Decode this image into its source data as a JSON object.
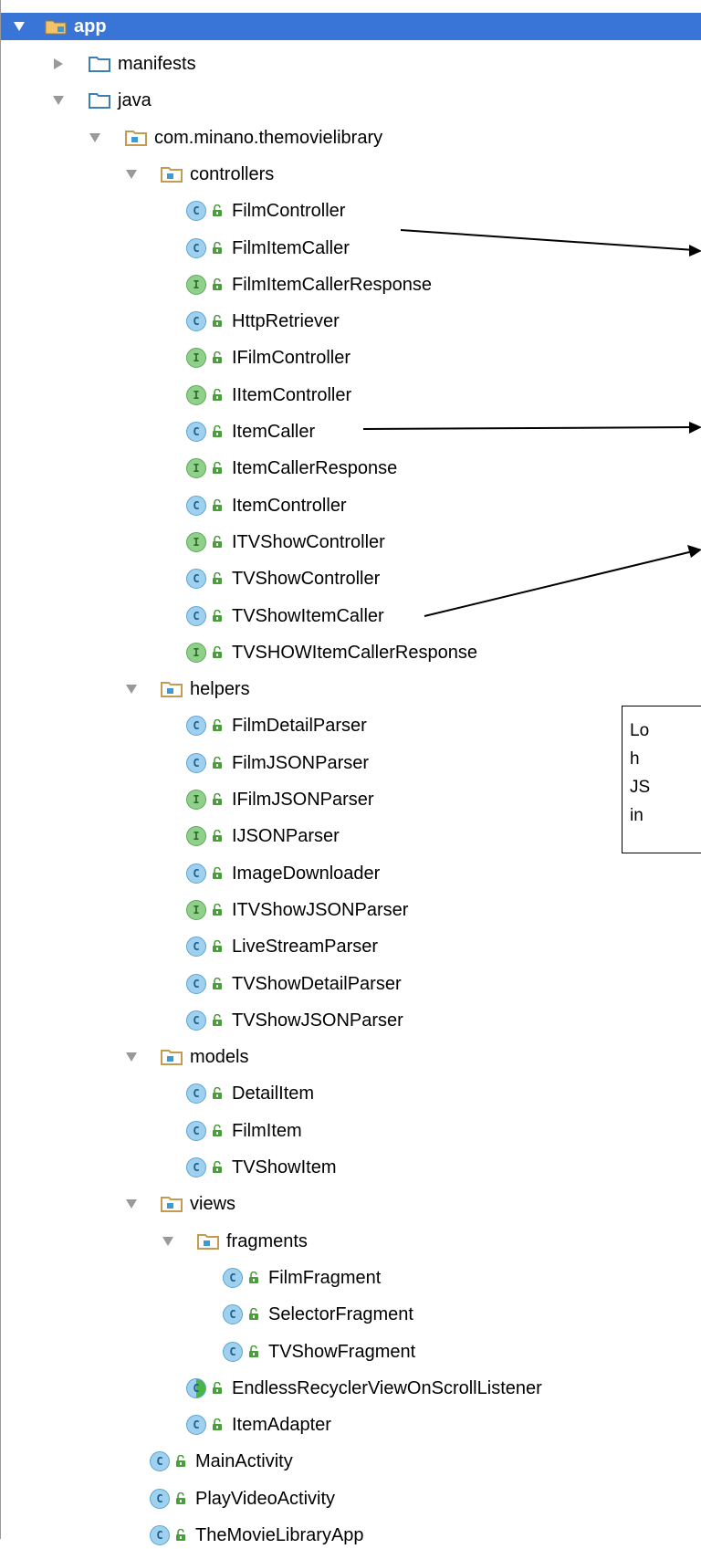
{
  "project_tree": {
    "root": {
      "label": "app"
    },
    "items": [
      {
        "label": "manifests",
        "kind": "folder",
        "depth": 1,
        "expanded": false
      },
      {
        "label": "java",
        "kind": "folder",
        "depth": 1,
        "expanded": true
      },
      {
        "label": "com.minano.themovielibrary",
        "kind": "package",
        "depth": 2,
        "expanded": true
      },
      {
        "label": "controllers",
        "kind": "package",
        "depth": 3,
        "expanded": true
      },
      {
        "label": "FilmController",
        "kind": "class",
        "depth": 4
      },
      {
        "label": "FilmItemCaller",
        "kind": "class",
        "depth": 4
      },
      {
        "label": "FilmItemCallerResponse",
        "kind": "interface",
        "depth": 4
      },
      {
        "label": "HttpRetriever",
        "kind": "class",
        "depth": 4
      },
      {
        "label": "IFilmController",
        "kind": "interface",
        "depth": 4
      },
      {
        "label": "IItemController",
        "kind": "interface",
        "depth": 4
      },
      {
        "label": "ItemCaller",
        "kind": "class",
        "depth": 4
      },
      {
        "label": "ItemCallerResponse",
        "kind": "interface",
        "depth": 4
      },
      {
        "label": "ItemController",
        "kind": "class",
        "depth": 4
      },
      {
        "label": "ITVShowController",
        "kind": "interface",
        "depth": 4
      },
      {
        "label": "TVShowController",
        "kind": "class",
        "depth": 4
      },
      {
        "label": "TVShowItemCaller",
        "kind": "class",
        "depth": 4
      },
      {
        "label": "TVSHOWItemCallerResponse",
        "kind": "interface",
        "depth": 4
      },
      {
        "label": "helpers",
        "kind": "package",
        "depth": 3,
        "expanded": true
      },
      {
        "label": "FilmDetailParser",
        "kind": "class",
        "depth": 4
      },
      {
        "label": "FilmJSONParser",
        "kind": "class",
        "depth": 4
      },
      {
        "label": "IFilmJSONParser",
        "kind": "interface",
        "depth": 4
      },
      {
        "label": "IJSONParser",
        "kind": "interface",
        "depth": 4
      },
      {
        "label": "ImageDownloader",
        "kind": "class",
        "depth": 4
      },
      {
        "label": "ITVShowJSONParser",
        "kind": "interface",
        "depth": 4
      },
      {
        "label": "LiveStreamParser",
        "kind": "class",
        "depth": 4
      },
      {
        "label": "TVShowDetailParser",
        "kind": "class",
        "depth": 4
      },
      {
        "label": "TVShowJSONParser",
        "kind": "class",
        "depth": 4
      },
      {
        "label": "models",
        "kind": "package",
        "depth": 3,
        "expanded": true
      },
      {
        "label": "DetailItem",
        "kind": "class",
        "depth": 4
      },
      {
        "label": "FilmItem",
        "kind": "class",
        "depth": 4
      },
      {
        "label": "TVShowItem",
        "kind": "class",
        "depth": 4
      },
      {
        "label": "views",
        "kind": "package",
        "depth": 3,
        "expanded": true
      },
      {
        "label": "fragments",
        "kind": "package",
        "depth": 4,
        "expanded": true
      },
      {
        "label": "FilmFragment",
        "kind": "class",
        "depth": 5
      },
      {
        "label": "SelectorFragment",
        "kind": "class",
        "depth": 5
      },
      {
        "label": "TVShowFragment",
        "kind": "class",
        "depth": 5
      },
      {
        "label": "EndlessRecyclerViewOnScrollListener",
        "kind": "abstract",
        "depth": 4
      },
      {
        "label": "ItemAdapter",
        "kind": "class",
        "depth": 4
      },
      {
        "label": "MainActivity",
        "kind": "class",
        "depth": 3
      },
      {
        "label": "PlayVideoActivity",
        "kind": "class",
        "depth": 3
      },
      {
        "label": "TheMovieLibraryApp",
        "kind": "class",
        "depth": 3
      }
    ]
  },
  "annotation_box": {
    "lines": [
      "Lo",
      "h",
      "JS",
      "in"
    ]
  },
  "icons": {
    "expanded": "triangle-down-icon",
    "collapsed": "triangle-right-icon",
    "module": "module-folder-icon",
    "folder": "folder-icon",
    "package": "package-icon",
    "class": "class-c-icon",
    "interface": "interface-i-icon",
    "abstract": "abstract-class-icon",
    "access": "public-lock-icon"
  },
  "colors": {
    "selection": "#3875d7",
    "class_badge": "#9fd1ef",
    "interface_badge": "#8fd18a",
    "folder": "#3c7fb1",
    "package": "#c59b53"
  }
}
